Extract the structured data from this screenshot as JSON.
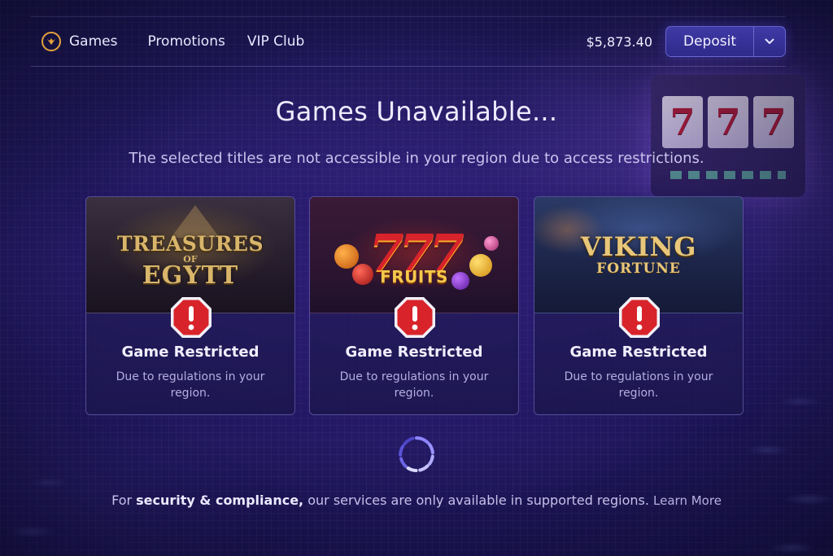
{
  "nav": {
    "links": [
      {
        "label": "Games"
      },
      {
        "label": "Promotions"
      },
      {
        "label": "VIP Club"
      }
    ],
    "balance": "$5,873.40",
    "deposit_label": "Deposit"
  },
  "main": {
    "title": "Games Unavailable...",
    "subtitle": "The selected titles are not accessible in your region due to access restrictions."
  },
  "cards": [
    {
      "art_text": [
        "TREASURES",
        "OF",
        "EGYTT"
      ],
      "status": "Game Restricted",
      "description": "Due to regulations in your region."
    },
    {
      "art_text": [
        "777",
        "FRUITS"
      ],
      "status": "Game Restricted",
      "description": "Due to regulations in your region."
    },
    {
      "art_text": [
        "VIKING",
        "FORTUNE"
      ],
      "status": "Game Restricted",
      "description": "Due to regulations in your region."
    }
  ],
  "footer": {
    "prefix": "For",
    "emphasis": "security & compliance,",
    "text": "our services are only available in supported regions.",
    "link": "Learn More"
  },
  "background": {
    "slot_reels": [
      "7",
      "7",
      "7"
    ]
  },
  "icons": {
    "logo": "logo-icon",
    "deposit_caret": "chevron-down-icon",
    "restricted": "warning-octagon-icon",
    "loading": "loading-spinner-icon"
  },
  "colors": {
    "accent": "#e6a23c",
    "warning": "#d8232a",
    "button": "#3f3aa6"
  }
}
